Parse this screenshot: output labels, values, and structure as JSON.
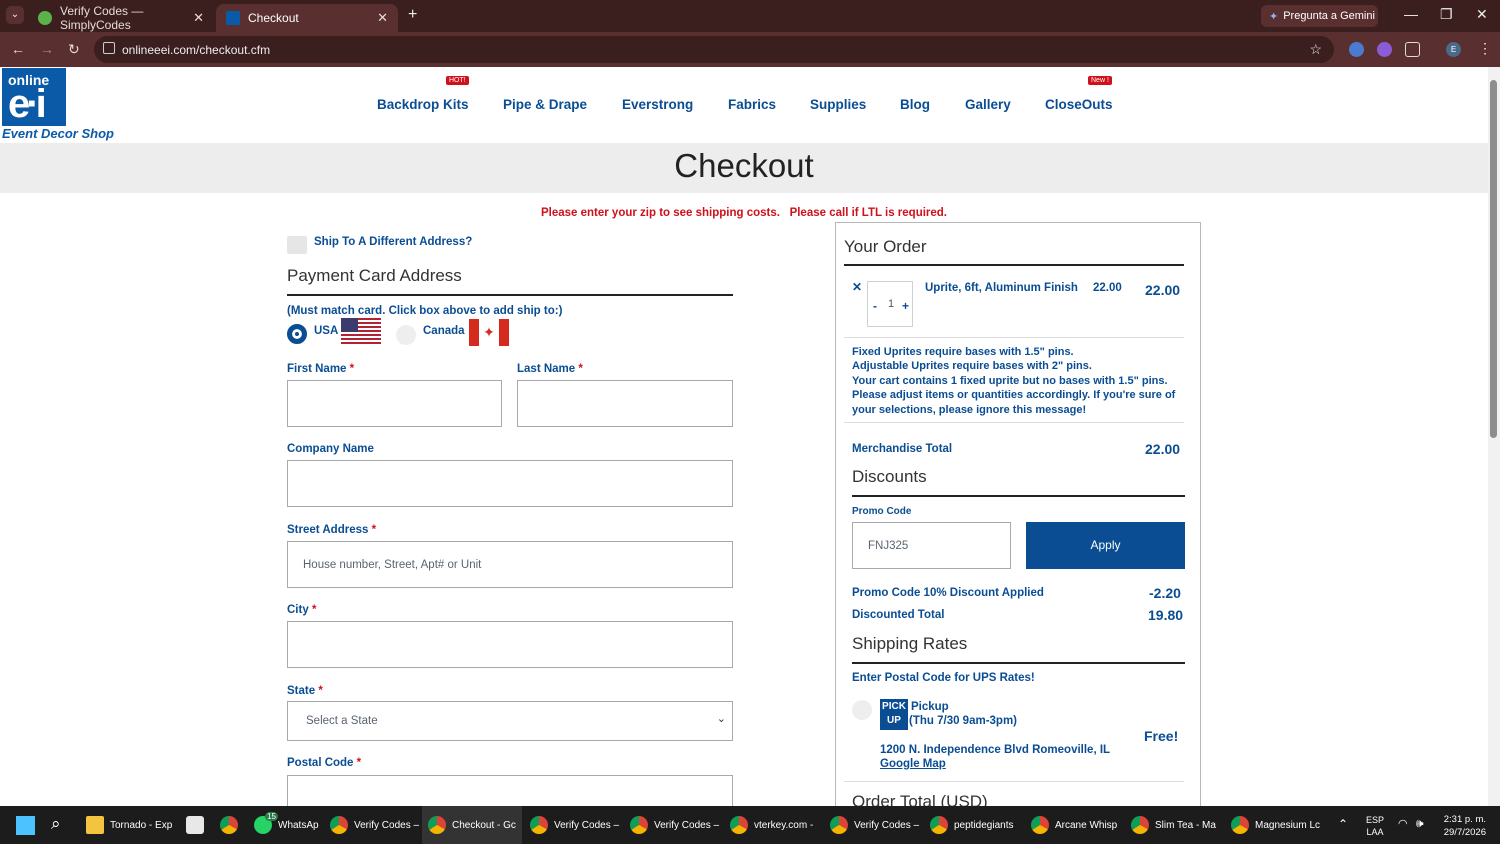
{
  "browser": {
    "tabs": [
      {
        "label": "Verify Codes — SimplyCodes",
        "close": "✕"
      },
      {
        "label": "Checkout",
        "close": "✕"
      }
    ],
    "new_tab": "+",
    "gemini": "Pregunta a Gemini",
    "url": "onlineeei.com/checkout.cfm",
    "nav_icons": [
      "←",
      "→",
      "↻"
    ],
    "window_controls": [
      "—",
      "❐",
      "✕"
    ]
  },
  "site": {
    "logo_top": "online",
    "logo_mark": "e·i",
    "logo_tagline": "Event Decor Shop",
    "menu": [
      {
        "label": "Backdrop Kits",
        "badge": "HOT!"
      },
      {
        "label": "Pipe & Drape",
        "badge": ""
      },
      {
        "label": "Everstrong",
        "badge": ""
      },
      {
        "label": "Fabrics",
        "badge": ""
      },
      {
        "label": "Supplies",
        "badge": ""
      },
      {
        "label": "Blog",
        "badge": ""
      },
      {
        "label": "Gallery",
        "badge": ""
      },
      {
        "label": "CloseOuts",
        "badge": "New !"
      }
    ],
    "page_title": "Checkout"
  },
  "warning": "Please enter your zip to see shipping costs.   Please call if LTL is required.",
  "form": {
    "ship_different": "Ship To A Different Address?",
    "section_title": "Payment Card Address",
    "note": "(Must match card. Click box above to add ship to:)",
    "country_usa": "USA",
    "country_canada": "Canada",
    "first_name": "First Name",
    "last_name": "Last Name",
    "company": "Company Name",
    "street": "Street Address",
    "street_placeholder": "House number, Street, Apt# or Unit",
    "city": "City",
    "state": "State",
    "state_select": "Select a State",
    "postal": "Postal Code",
    "required_mark": "*"
  },
  "order": {
    "title": "Your Order",
    "item": {
      "remove": "✕",
      "minus": "-",
      "qty": "1",
      "plus": "+",
      "name": "Uprite, 6ft, Aluminum Finish",
      "unit_price": "22.00",
      "total": "22.00"
    },
    "notice": "Fixed Uprites require bases with 1.5\" pins.\nAdjustable Uprites require bases with 2\" pins.\nYour cart contains 1 fixed uprite but no bases with 1.5\" pins.\nPlease adjust items or quantities accordingly. If you're sure of your selections, please ignore this message!",
    "merch_label": "Merchandise Total",
    "merch_value": "22.00",
    "discounts_title": "Discounts",
    "promo_label": "Promo Code",
    "promo_value": "FNJ325",
    "apply": "Apply",
    "promo_applied": "Promo Code 10% Discount Applied",
    "promo_amount": "-2.20",
    "disc_total_label": "Discounted Total",
    "disc_total_value": "19.80",
    "shipping_title": "Shipping Rates",
    "ups_note": "Enter Postal Code for UPS Rates!",
    "pickup_badge": "PICK UP",
    "pickup_name": "Pickup",
    "pickup_time": "(Thu 7/30 9am-3pm)",
    "pickup_price": "Free!",
    "pickup_address": "1200 N. Independence Blvd Romeoville, IL",
    "map_link": "Google Map",
    "order_total": "Order Total (USD)"
  },
  "taskbar": {
    "items": [
      "Tornado - Exp",
      "WhatsAp",
      "Verify Codes –",
      "Checkout - Gc",
      "Verify Codes –",
      "Verify Codes –",
      "vterkey.com -",
      "Verify Codes –",
      "peptidegiants",
      "Arcane Whisp",
      "Slim Tea - Ma",
      "Magnesium Lc"
    ],
    "lang": "ESP",
    "lang2": "LAA",
    "time": "2:31 p. m.",
    "date": "29/7/2026",
    "badge_whatsapp": "15"
  },
  "colors": {
    "brand": "#0a4d93",
    "alert": "#d0101a",
    "tab_bar": "#3b1e1e"
  }
}
